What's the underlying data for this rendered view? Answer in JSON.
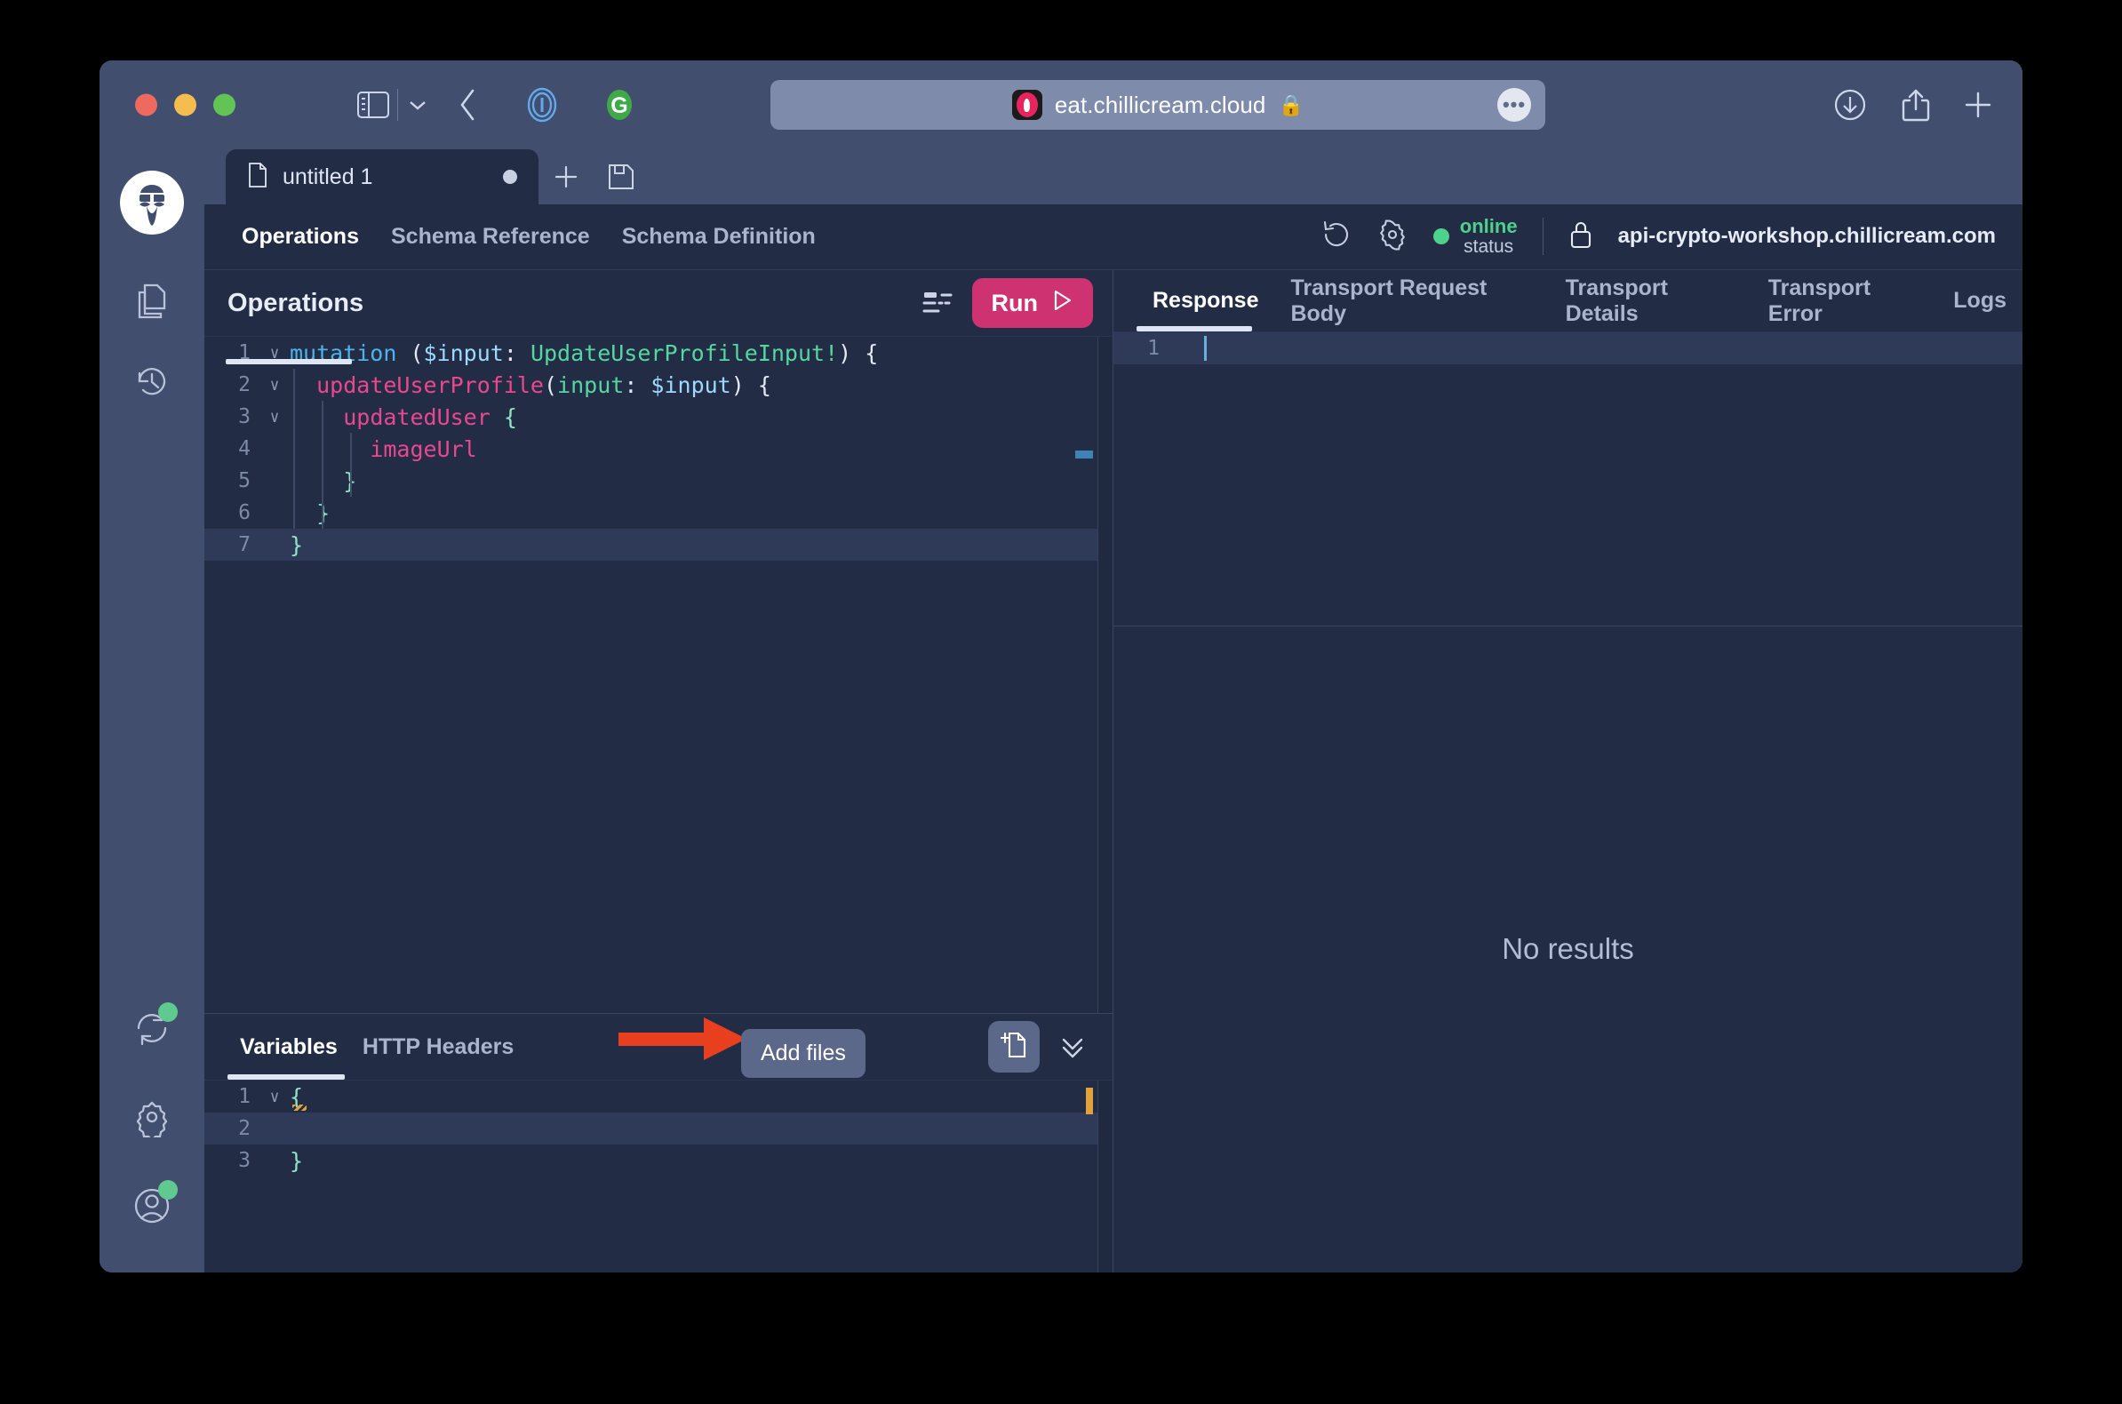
{
  "browser": {
    "url": "eat.chillicream.cloud",
    "lock_glyph": "🔒",
    "more_label": "•••"
  },
  "app": {
    "doc_tab": {
      "label": "untitled 1"
    },
    "schema_tabs": [
      {
        "label": "Operations",
        "active": true
      },
      {
        "label": "Schema Reference",
        "active": false
      },
      {
        "label": "Schema Definition",
        "active": false
      }
    ],
    "status": {
      "online": "online",
      "label": "status"
    },
    "endpoint": "api-crypto-workshop.chillicream.com"
  },
  "operations": {
    "title": "Operations",
    "run_label": "Run",
    "code_lines": [
      {
        "n": "1",
        "fold": "∨",
        "tokens": [
          {
            "t": "mutation",
            "c": "tok-kw"
          },
          {
            "t": " (",
            "c": "tok-plain"
          },
          {
            "t": "$input",
            "c": "tok-var"
          },
          {
            "t": ": ",
            "c": "tok-plain"
          },
          {
            "t": "UpdateUserProfileInput!",
            "c": "tok-type"
          },
          {
            "t": ") {",
            "c": "tok-plain"
          }
        ]
      },
      {
        "n": "2",
        "fold": "∨",
        "tokens": [
          {
            "t": "  ",
            "c": "tok-plain"
          },
          {
            "t": "updateUserProfile",
            "c": "tok-field"
          },
          {
            "t": "(",
            "c": "tok-plain"
          },
          {
            "t": "input",
            "c": "tok-type"
          },
          {
            "t": ": ",
            "c": "tok-plain"
          },
          {
            "t": "$input",
            "c": "tok-var"
          },
          {
            "t": ") {",
            "c": "tok-plain"
          }
        ]
      },
      {
        "n": "3",
        "fold": "∨",
        "tokens": [
          {
            "t": "    ",
            "c": "tok-plain"
          },
          {
            "t": "updatedUser",
            "c": "tok-field"
          },
          {
            "t": " {",
            "c": "tok-brace"
          }
        ]
      },
      {
        "n": "4",
        "fold": "",
        "tokens": [
          {
            "t": "      ",
            "c": "tok-plain"
          },
          {
            "t": "imageUrl",
            "c": "tok-field"
          }
        ]
      },
      {
        "n": "5",
        "fold": "",
        "tokens": [
          {
            "t": "    }",
            "c": "tok-brace"
          }
        ]
      },
      {
        "n": "6",
        "fold": "",
        "tokens": [
          {
            "t": "  }",
            "c": "tok-brace"
          }
        ]
      },
      {
        "n": "7",
        "fold": "",
        "cur": true,
        "tokens": [
          {
            "t": "}",
            "c": "tok-brace"
          }
        ]
      }
    ]
  },
  "variables": {
    "tabs": [
      {
        "label": "Variables",
        "active": true
      },
      {
        "label": "HTTP Headers",
        "active": false
      }
    ],
    "tooltip": "Add files",
    "code_lines": [
      {
        "n": "1",
        "fold": "∨",
        "tokens": [
          {
            "t": "{",
            "c": "tok-brace"
          }
        ]
      },
      {
        "n": "2",
        "fold": "",
        "cur": true,
        "tokens": [
          {
            "t": "  ",
            "c": "tok-plain"
          }
        ]
      },
      {
        "n": "3",
        "fold": "",
        "tokens": [
          {
            "t": "}",
            "c": "tok-brace"
          }
        ]
      }
    ]
  },
  "response": {
    "tabs": [
      {
        "label": "Response",
        "active": true
      },
      {
        "label": "Transport Request Body",
        "active": false
      },
      {
        "label": "Transport Details",
        "active": false
      },
      {
        "label": "Transport Error",
        "active": false
      },
      {
        "label": "Logs",
        "active": false
      }
    ],
    "line_number": "1",
    "empty_text": "No results"
  },
  "colors": {
    "window_chrome": "#414e6e",
    "app_bg": "#222d45",
    "accent_run": "#cf3271",
    "status_green": "#4ed18a",
    "annotation_arrow": "#e8401f",
    "tooltip_bg": "#5b688a"
  }
}
